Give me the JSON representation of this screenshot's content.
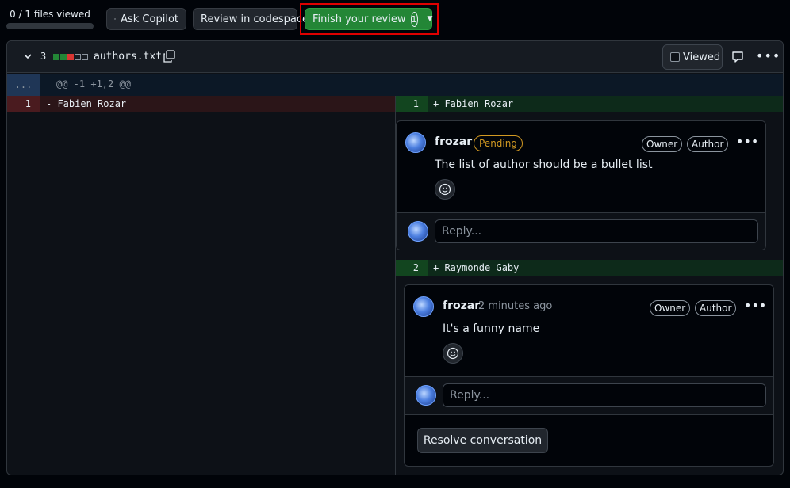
{
  "top_bar": {
    "files_viewed": "0 / 1 files viewed",
    "files_viewed_progress": 0,
    "ask_copilot": "Ask Copilot",
    "review_codespace": "Review in codespace",
    "finish_review": "Finish your review",
    "finish_review_count": "1"
  },
  "file": {
    "change_count": "3",
    "diffstat": [
      "added",
      "added",
      "deleted",
      "neutral",
      "neutral"
    ],
    "name": "authors.txt",
    "viewed_label": "Viewed"
  },
  "colors": {
    "added": "#238636",
    "deleted": "#da3633",
    "neutral": "#30363d",
    "accent_green": "#238636",
    "highlight_red": "#e00000"
  },
  "diff": {
    "expand": "...",
    "hunk_header": "@@ -1 +1,2 @@",
    "left": [
      {
        "num": "1",
        "text": "- Fabien Rozar"
      }
    ],
    "right": [
      {
        "num": "1",
        "text": "+ Fabien Rozar"
      },
      {
        "num": "2",
        "text": "+ Raymonde Gaby"
      }
    ]
  },
  "threads": [
    {
      "author": "frozar",
      "pending": "Pending",
      "owner": "Owner",
      "author_label": "Author",
      "body": "The list of author should be a bullet list",
      "reply_placeholder": "Reply..."
    },
    {
      "author": "frozar",
      "time": "2 minutes ago",
      "owner": "Owner",
      "author_label": "Author",
      "body": "It's a funny name",
      "reply_placeholder": "Reply...",
      "resolve": "Resolve conversation"
    }
  ]
}
